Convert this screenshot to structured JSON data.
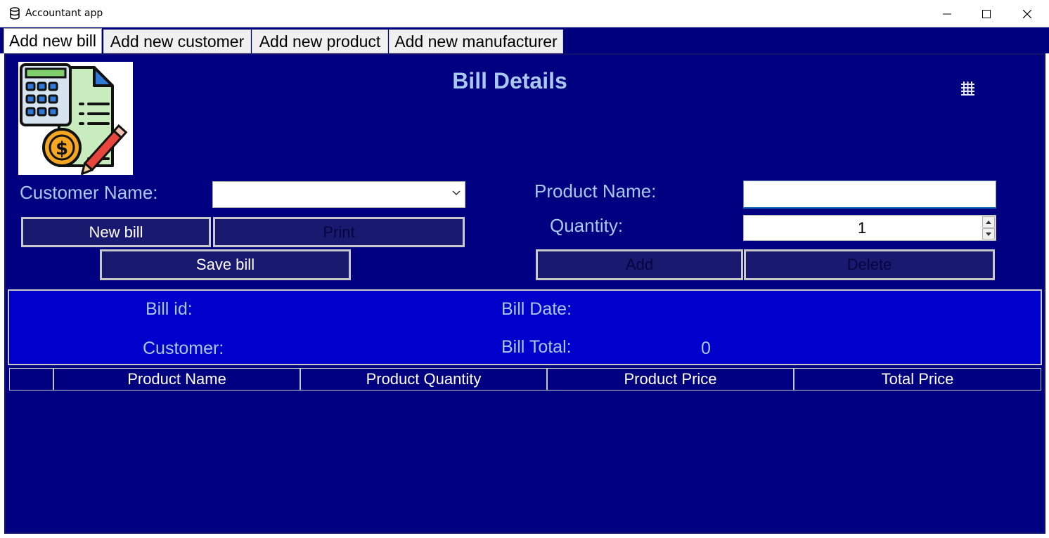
{
  "window": {
    "title": "Accountant app",
    "icon": "database-icon",
    "controls": [
      "minimize-icon",
      "maximize-icon",
      "close-icon"
    ]
  },
  "tabs": [
    {
      "label": "Add new bill",
      "active": true
    },
    {
      "label": "Add new customer",
      "active": false
    },
    {
      "label": "Add new product",
      "active": false
    },
    {
      "label": "Add new manufacturer",
      "active": false
    }
  ],
  "page": {
    "heading": "Bill Details",
    "logo": "bill-calculator-icon",
    "grid_icon": "hash-grid-icon"
  },
  "form": {
    "customer_label": "Customer Name:",
    "customer_value": "",
    "product_label": "Product Name:",
    "product_value": "",
    "quantity_label": "Quantity:",
    "quantity_value": "1"
  },
  "buttons": {
    "new_bill": "New bill",
    "print": "Print",
    "save_bill": "Save bill",
    "add": "Add",
    "delete": "Delete"
  },
  "info": {
    "bill_id_label": "Bill id:",
    "bill_date_label": "Bill Date:",
    "customer_label": "Customer:",
    "bill_total_label": "Bill Total:",
    "bill_total_value": "0"
  },
  "table": {
    "columns": [
      "",
      "Product Name",
      "Product Quantity",
      "Product Price",
      "Total Price"
    ],
    "rows": []
  },
  "colors": {
    "background": "#000080",
    "info_panel": "#0000cc",
    "label_text": "#a8c8ee",
    "button_bg": "#191970"
  }
}
